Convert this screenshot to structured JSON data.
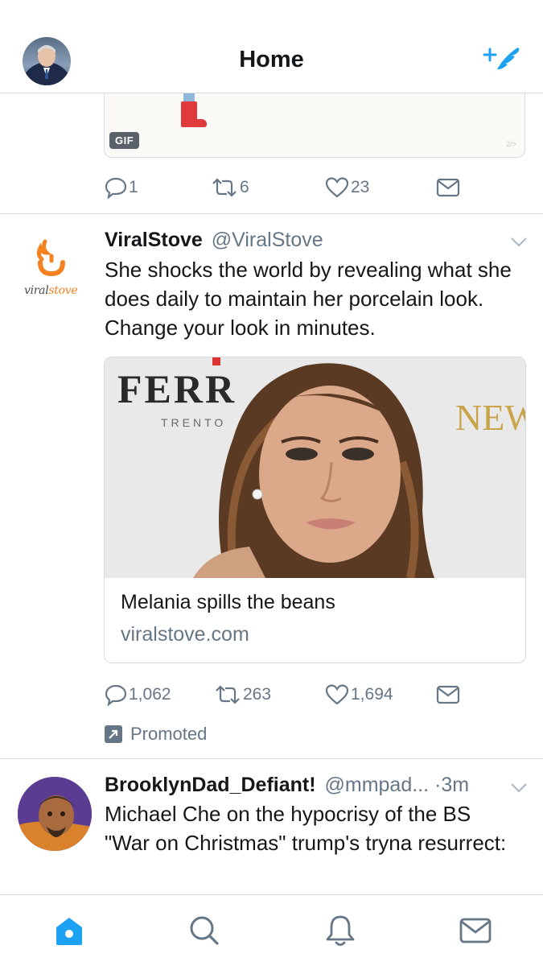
{
  "header": {
    "title": "Home",
    "compose_icon": "compose-tweet-icon"
  },
  "colors": {
    "accent": "#1da1f2",
    "muted": "#657786",
    "border": "#d5dbe0",
    "brand_orange": "#f58220"
  },
  "prev_tweet": {
    "gif_badge": "GIF",
    "gif_corner": "2/>",
    "replies": "1",
    "retweets": "6",
    "likes": "23"
  },
  "promoted_tweet": {
    "name": "ViralStove",
    "handle": "@ViralStove",
    "brand_word_prefix": "viral",
    "brand_word_suffix": "stove",
    "text": "She shocks the world by revealing what she does daily to maintain her porcelain look. Change your look in minutes.",
    "card": {
      "title": "Melania spills the beans",
      "domain": "viralstove.com",
      "image_text_left": "FERR",
      "image_text_sub": "TRENTO",
      "image_text_right": "NEW"
    },
    "replies": "1,062",
    "retweets": "263",
    "likes": "1,694",
    "promoted_label": "Promoted"
  },
  "next_tweet": {
    "name": "BrooklynDad_Defiant!",
    "handle": "@mmpad...",
    "time": "·3m",
    "text": "Michael Che on the hypocrisy of the BS \"War on Christmas\" trump's tryna resurrect:"
  },
  "tabbar": {
    "items": [
      "home-icon",
      "search-icon",
      "notifications-icon",
      "messages-icon"
    ],
    "active": "home-icon"
  }
}
